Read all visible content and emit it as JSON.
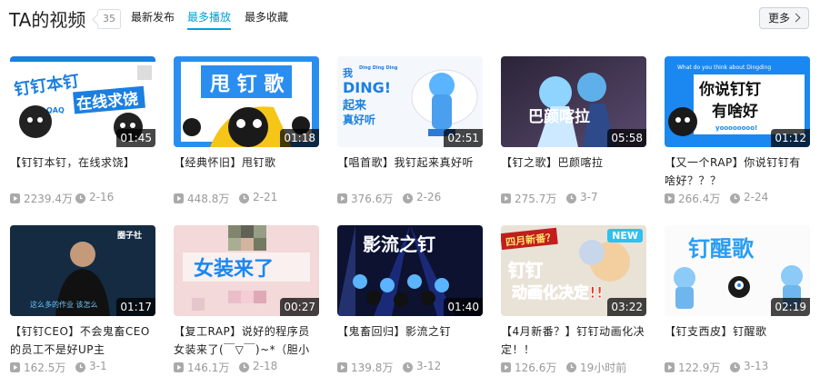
{
  "header": {
    "title": "TA的视频",
    "count": "35",
    "tabs": [
      {
        "label": "最新发布",
        "active": false
      },
      {
        "label": "最多播放",
        "active": true
      },
      {
        "label": "最多收藏",
        "active": false
      }
    ],
    "more_label": "更多"
  },
  "colors": {
    "accent": "#00a1d6",
    "meta_gray": "#999999",
    "duration_bg": "#000000"
  },
  "videos": [
    {
      "title": "【钉钉本钉，在线求饶】",
      "duration": "01:45",
      "plays": "2239.4万",
      "date": "2-16",
      "thumb_text": [
        "钉钉本钉",
        "在线求饶",
        "QAQ"
      ],
      "thumb_theme": "blue-white"
    },
    {
      "title": "【经典怀旧】甩钉歌",
      "duration": "01:18",
      "plays": "448.8万",
      "date": "2-21",
      "thumb_text": [
        "甩 钉 歌"
      ],
      "thumb_theme": "blue-yellow"
    },
    {
      "title": "【唱首歌】我钉起来真好听",
      "duration": "02:51",
      "plays": "376.6万",
      "date": "2-26",
      "thumb_text": [
        "我",
        "DING!",
        "起来",
        "真好听",
        "Ding Ding Ding"
      ],
      "thumb_theme": "white-anime"
    },
    {
      "title": "【钉之歌】巴颜喀拉",
      "duration": "05:58",
      "plays": "275.7万",
      "date": "3-7",
      "thumb_text": [
        "巴颜喀拉"
      ],
      "thumb_theme": "dark-anime"
    },
    {
      "title": "【又一个RAP】你说钉钉有啥好？？？",
      "duration": "01:12",
      "plays": "266.4万",
      "date": "2-24",
      "thumb_text": [
        "What do you think about Dingding",
        "你说钉钉",
        "有啥好",
        "yoooooooo!"
      ],
      "thumb_theme": "blue-white-box"
    },
    {
      "title": "【钉钉CEO】不会鬼畜CEO的员工不是好UP主",
      "duration": "01:17",
      "plays": "162.5万",
      "date": "3-1",
      "thumb_text": [
        "圈子社",
        "这么多的作业 该怎么"
      ],
      "thumb_theme": "dark-person"
    },
    {
      "title": "【复工RAP】说好的程序员女装来了(￣▽￣)~*（胆小者勿",
      "duration": "00:27",
      "plays": "146.1万",
      "date": "2-18",
      "thumb_text": [
        "女装来了"
      ],
      "thumb_theme": "pink-mosaic"
    },
    {
      "title": "【鬼畜回归】影流之钉",
      "duration": "01:40",
      "plays": "139.8万",
      "date": "3-12",
      "thumb_text": [
        "影流之钉"
      ],
      "thumb_theme": "stage"
    },
    {
      "title": "【4月新番？】钉钉动画化决定！！",
      "duration": "03:22",
      "plays": "126.6万",
      "date": "19小时前",
      "thumb_text": [
        "四月新番？",
        "钉钉",
        "动画化决定!!",
        "NEW"
      ],
      "thumb_theme": "anime-poster"
    },
    {
      "title": "【钉支西皮】钉醒歌",
      "duration": "02:19",
      "plays": "122.9万",
      "date": "3-13",
      "thumb_text": [
        "钉醒歌"
      ],
      "thumb_theme": "white-drawing"
    }
  ]
}
